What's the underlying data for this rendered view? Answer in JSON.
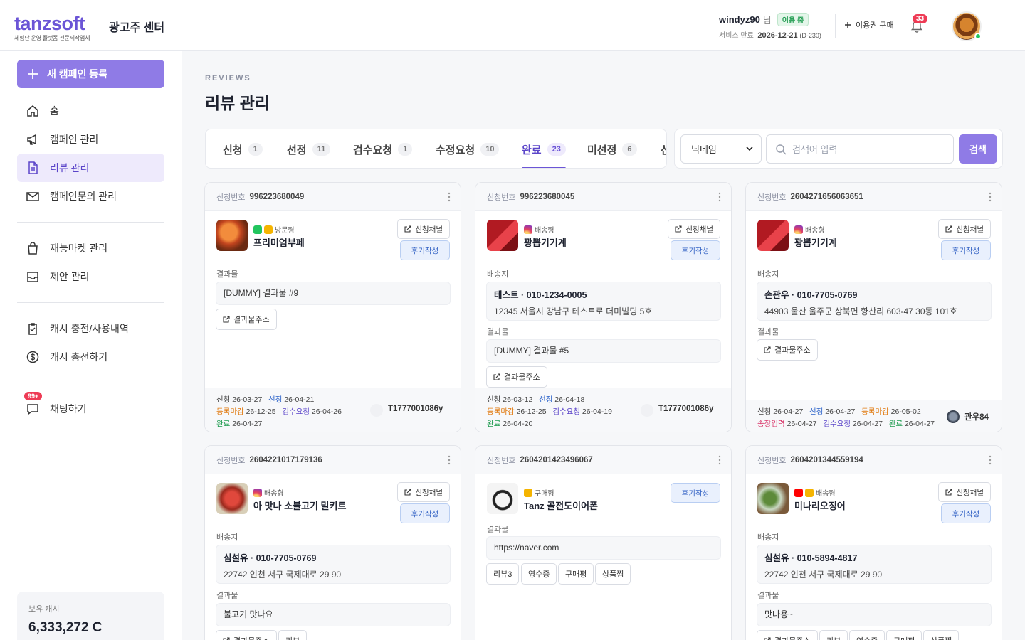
{
  "brand": {
    "logo_text_a": "tanz",
    "logo_text_b": "soft",
    "logo_sub": "체험단 운영 플랫폼 전문제작업체",
    "center_name": "광고주 센터",
    "accent": "#6b55d6"
  },
  "user": {
    "id": "windyz90",
    "suffix": "님",
    "status": "이용 중",
    "service_label": "서비스 만료",
    "service_date": "2026-12-21",
    "service_dday": "(D-230)",
    "buy_label": "이용권 구매",
    "notif_count": "33"
  },
  "sidebar": {
    "new_campaign": "새 캠페인 등록",
    "items": [
      {
        "label": "홈",
        "icon": "home-icon"
      },
      {
        "label": "캠페인 관리",
        "icon": "megaphone-icon"
      },
      {
        "label": "리뷰 관리",
        "icon": "document-icon"
      },
      {
        "label": "캠페인문의 관리",
        "icon": "mail-icon"
      },
      {
        "label": "재능마켓 관리",
        "icon": "bag-icon"
      },
      {
        "label": "제안 관리",
        "icon": "inbox-icon"
      },
      {
        "label": "캐시 충전/사용내역",
        "icon": "clipboard-check-icon"
      },
      {
        "label": "캐시 충전하기",
        "icon": "dollar-icon"
      },
      {
        "label": "채팅하기",
        "icon": "chat-icon"
      }
    ],
    "chat_badge": "99+",
    "cash_label": "보유 캐시",
    "cash_value": "6,333,272 C"
  },
  "page": {
    "eyebrow": "REVIEWS",
    "title": "리뷰 관리"
  },
  "tabs": [
    {
      "label": "신청",
      "count": "1"
    },
    {
      "label": "선정",
      "count": "11"
    },
    {
      "label": "검수요청",
      "count": "1"
    },
    {
      "label": "수정요청",
      "count": "10"
    },
    {
      "label": "완료",
      "count": "23"
    },
    {
      "label": "미선정",
      "count": "6"
    },
    {
      "label": "신",
      "count": ""
    }
  ],
  "search": {
    "select_value": "닉네임",
    "placeholder": "검색어 입력",
    "button": "검색"
  },
  "common": {
    "app_no_label": "신청번호",
    "channel_btn": "신청채널",
    "review_btn": "후기작성",
    "result_label": "결과물",
    "ship_label": "배송지",
    "result_url_btn": "결과물주소"
  },
  "cards": [
    {
      "app_no": "996223680049",
      "platform_type": "방문형",
      "product": "프리미엄부페",
      "result": "[DUMMY] 결과물 #9",
      "f_apply": "26-03-27",
      "f_select": "26-04-21",
      "f_regdl": "26-12-25",
      "f_review": "26-04-26",
      "f_done": "26-04-27",
      "owner": "T1777001086y"
    },
    {
      "app_no": "996223680045",
      "platform_type": "배송형",
      "product": "꽝뽑기기계",
      "ship_who": "테스트 · 010-1234-0005",
      "ship_addr": "12345 서울시 강남구 테스트로 더미빌딩 5호",
      "result": "[DUMMY] 결과물 #5",
      "f_apply": "26-03-12",
      "f_select": "26-04-18",
      "f_regdl": "26-12-25",
      "f_review": "26-04-19",
      "f_done": "26-04-20",
      "owner": "T1777001086y"
    },
    {
      "app_no": "2604271656063651",
      "platform_type": "배송형",
      "product": "꽝뽑기기계",
      "ship_who": "손관우 · 010-7705-0769",
      "ship_addr": "44903 울산 울주군 상북면 향산리 603-47 30동 101호",
      "f_apply": "26-04-27",
      "f_select": "26-04-27",
      "f_regdl": "26-05-02",
      "f_ship": "26-04-27",
      "f_review": "26-04-27",
      "f_done": "26-04-27",
      "label_ship": "송장입력",
      "owner": "관우84"
    },
    {
      "app_no": "2604221017179136",
      "platform_type": "배송형",
      "product": "아 맛나 소불고기 밀키트",
      "ship_who": "심설유 · 010-7705-0769",
      "ship_addr": "22742 인천 서구 국제대로 29 90",
      "result": "불고기 맛나요",
      "tag": "리뷰"
    },
    {
      "app_no": "2604201423496067",
      "platform_type": "구매형",
      "product": "Tanz 골전도이어폰",
      "result": "https://naver.com",
      "tags": [
        "리뷰3",
        "영수증",
        "구매평",
        "상품찜"
      ]
    },
    {
      "app_no": "2604201344559194",
      "platform_type": "배송형",
      "product": "미나리오징어",
      "ship_who": "심설유 · 010-5894-4817",
      "ship_addr": "22742 인천 서구 국제대로 29 90",
      "result": "맛나용~",
      "tags": [
        "리뷰",
        "영수증",
        "구매평",
        "상품찜"
      ]
    }
  ],
  "foot_labels": {
    "apply": "신청",
    "select": "선정",
    "regdl": "등록마감",
    "review": "검수요청",
    "done": "완료"
  }
}
